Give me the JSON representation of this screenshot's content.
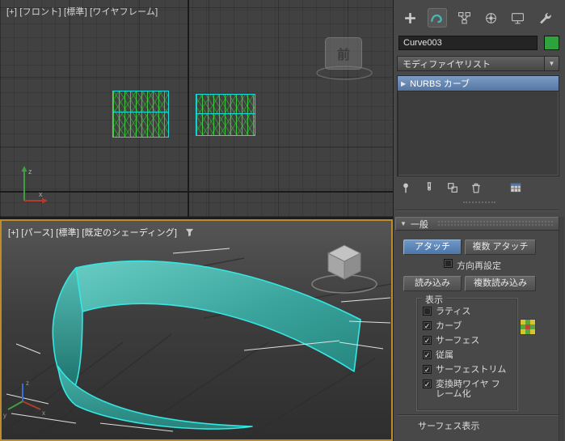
{
  "icons": {
    "triangle_right": "▶",
    "triangle_down": "▼",
    "check": "✓"
  },
  "viewport_front": {
    "label": "[+] [フロント] [標準] [ワイヤフレーム]",
    "viewcube_label": "前",
    "axis_x": "x",
    "axis_z": "z"
  },
  "viewport_persp": {
    "label": "[+] [パース] [標準] [既定のシェーディング]",
    "axis_x": "x",
    "axis_y": "y",
    "axis_z": "z"
  },
  "command_panel": {
    "object_name": "Curve003",
    "modifier_list": "モディファイヤリスト",
    "stack_item": "NURBS カーブ",
    "rollout_general": "一般",
    "attach": "アタッチ",
    "multi_attach": "複数 アタッチ",
    "reorient": "方向再設定",
    "reorient_mark": "",
    "import": "読み込み",
    "multi_import": "複数読み込み",
    "display_legend": "表示",
    "display_items": [
      {
        "label": "ラティス",
        "mark": ""
      },
      {
        "label": "カーブ",
        "mark": "✓"
      },
      {
        "label": "サーフェス",
        "mark": "✓"
      },
      {
        "label": "従属",
        "mark": "✓"
      },
      {
        "label": "サーフェストリム",
        "mark": "✓"
      },
      {
        "label": "変換時ワイヤ フレーム化",
        "mark": "✓"
      }
    ],
    "surface_display": "サーフェス表示"
  },
  "colors": {
    "active_viewport_border": "#bd8d2a",
    "selection_blue": "#5476a3",
    "attach_active": "#4c76a7",
    "surface_teal": "#3aa49c",
    "curve_cyan": "#35e6e2",
    "lattice_green": "#2daf2d",
    "object_color_swatch": "#2ea23c"
  }
}
